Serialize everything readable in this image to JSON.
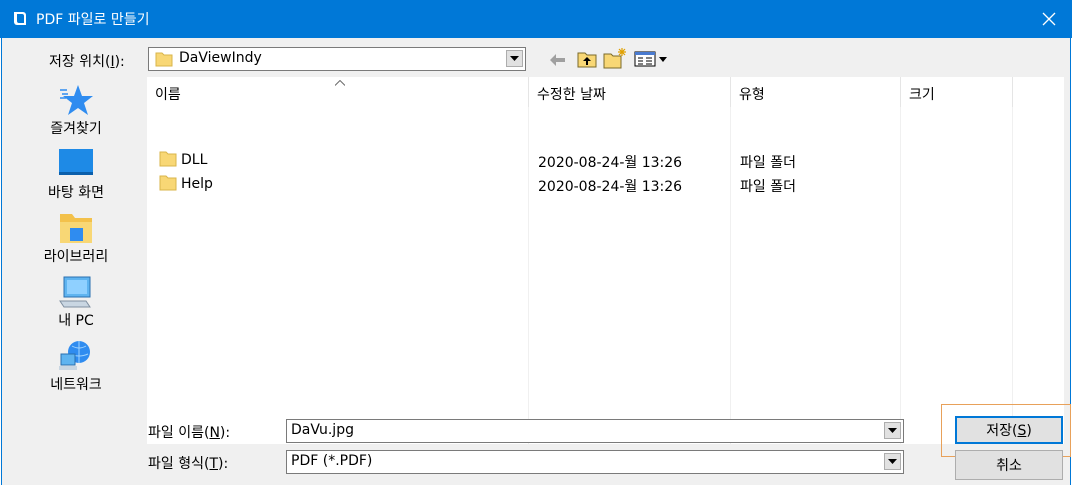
{
  "window": {
    "title": "PDF 파일로 만들기"
  },
  "location": {
    "label_prefix": "저장 위치(",
    "label_key": "I",
    "label_suffix": "):",
    "value": "DaViewIndy"
  },
  "places": [
    {
      "label": "즐겨찾기",
      "icon": "star-icon"
    },
    {
      "label": "바탕 화면",
      "icon": "desktop-icon"
    },
    {
      "label": "라이브러리",
      "icon": "library-icon"
    },
    {
      "label": "내 PC",
      "icon": "computer-icon"
    },
    {
      "label": "네트워크",
      "icon": "network-icon"
    }
  ],
  "columns": {
    "name": "이름",
    "modified": "수정한 날짜",
    "type": "유형",
    "size": "크기"
  },
  "files": [
    {
      "name": "DLL",
      "modified": "2020-08-24-월 13:26",
      "type": "파일 폴더",
      "size": ""
    },
    {
      "name": "Help",
      "modified": "2020-08-24-월 13:26",
      "type": "파일 폴더",
      "size": ""
    }
  ],
  "filename": {
    "label_prefix": "파일 이름(",
    "label_key": "N",
    "label_suffix": "):",
    "value": "DaVu.jpg"
  },
  "filetype": {
    "label_prefix": "파일 형식(",
    "label_key": "T",
    "label_suffix": "):",
    "value": "PDF (*.PDF)"
  },
  "buttons": {
    "save_prefix": "저장(",
    "save_key": "S",
    "save_suffix": ")",
    "cancel": "취소"
  },
  "colors": {
    "titlebar": "#0078d7",
    "highlight_box": "#e8a15a",
    "folder": "#f8d775"
  }
}
